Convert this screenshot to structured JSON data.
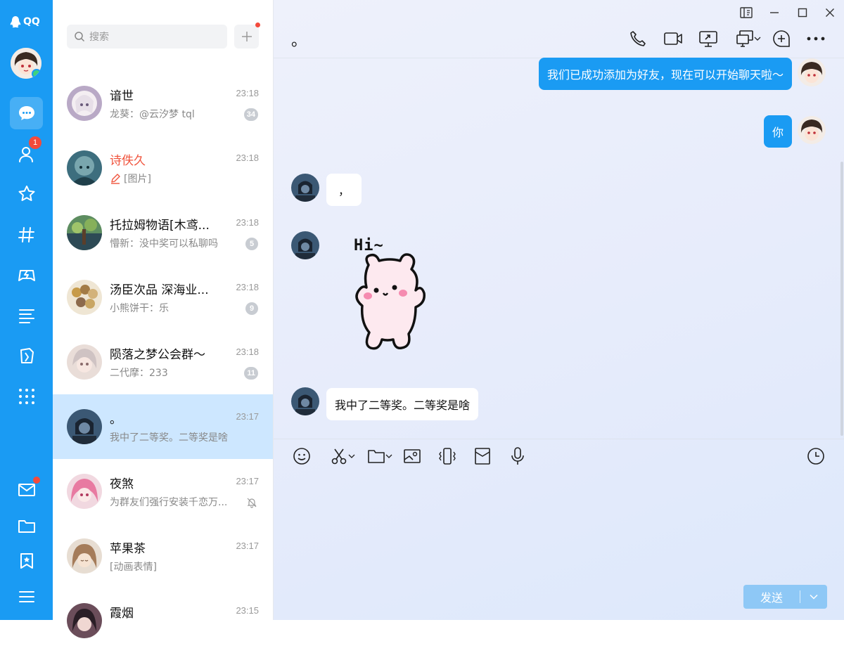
{
  "app": {
    "logo_text": "QQ"
  },
  "rail": {
    "contacts_badge": "1",
    "items": [
      "chat",
      "contacts",
      "favorites",
      "channels",
      "games",
      "feeds",
      "mini-apps",
      "apps"
    ]
  },
  "search": {
    "placeholder": "搜索"
  },
  "conversations": [
    {
      "name": "谙世",
      "time": "23:18",
      "preview": "龙葵：@云汐梦 tql",
      "count": "34"
    },
    {
      "name": "诗佚久",
      "time": "23:18",
      "preview": "[图片]",
      "draft": true
    },
    {
      "name": "托拉姆物语[木鸢...",
      "time": "23:18",
      "preview": "懵新：没中奖可以私聊吗",
      "count": "5"
    },
    {
      "name": "汤臣次品 深海业...",
      "time": "23:18",
      "preview": "小熊饼干：乐",
      "count": "9"
    },
    {
      "name": "陨落之梦公会群～",
      "time": "23:18",
      "preview": "二代摩：233",
      "count": "11"
    },
    {
      "name": "。",
      "time": "23:17",
      "preview": "我中了二等奖。二等奖是啥"
    },
    {
      "name": "夜煞",
      "time": "23:17",
      "preview": "为群友们强行安装千恋万...",
      "muted": true
    },
    {
      "name": "苹果茶",
      "time": "23:17",
      "preview": "[动画表情]"
    },
    {
      "name": "霞烟",
      "time": "23:15",
      "preview": ""
    }
  ],
  "chat": {
    "title": "。",
    "messages": [
      {
        "side": "right",
        "text": "我们已成功添加为好友，现在可以开始聊天啦～"
      },
      {
        "side": "right",
        "text": "你"
      },
      {
        "side": "left",
        "text": "，"
      },
      {
        "side": "left",
        "sticker_text": "Hi~"
      },
      {
        "side": "left",
        "text": "我中了二等奖。二等奖是啥"
      }
    ],
    "send_label": "发送"
  },
  "colors": {
    "accent": "#1a9bf3",
    "badge": "#f34a3c",
    "active_row": "#cde7ff"
  }
}
